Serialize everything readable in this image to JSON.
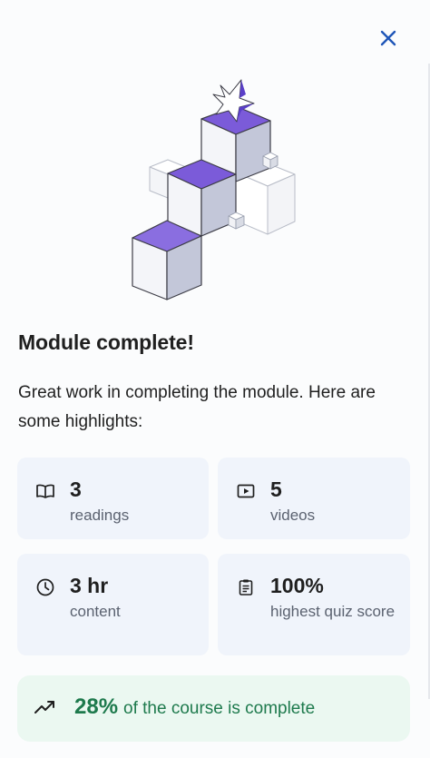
{
  "header": {
    "close_icon": "close-icon"
  },
  "illustration": {
    "name": "module-complete-cubes",
    "accent": "#7b5bd9"
  },
  "title": "Module complete!",
  "subtitle": "Great work in completing the module. Here are some highlights:",
  "highlights": [
    {
      "icon": "book-icon",
      "value": "3",
      "label": "readings"
    },
    {
      "icon": "video-icon",
      "value": "5",
      "label": "videos"
    },
    {
      "icon": "clock-icon",
      "value": "3 hr",
      "label": "content"
    },
    {
      "icon": "clipboard-icon",
      "value": "100%",
      "label": "highest quiz score"
    }
  ],
  "progress": {
    "icon": "trending-up-icon",
    "percent": "28%",
    "text": "of the course is complete",
    "color": "#1e7a4d"
  },
  "colors": {
    "card_bg": "#f0f4fb",
    "progress_bg": "#ebf8f1",
    "close": "#1f56b8"
  }
}
